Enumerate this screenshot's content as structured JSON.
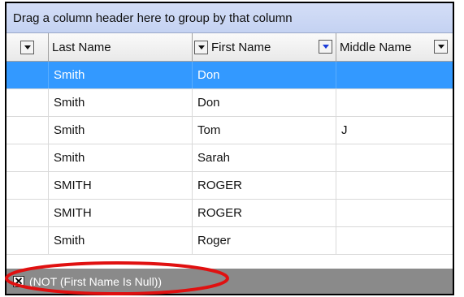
{
  "group_panel": {
    "text": "Drag a column header here to group by that column"
  },
  "columns": [
    {
      "label": "Last Name"
    },
    {
      "label": "First Name"
    },
    {
      "label": "Middle Name"
    }
  ],
  "rows": [
    {
      "last": "Smith",
      "first": "Don",
      "middle": "",
      "selected": true
    },
    {
      "last": "Smith",
      "first": "Don",
      "middle": ""
    },
    {
      "last": "Smith",
      "first": "Tom",
      "middle": "J"
    },
    {
      "last": "Smith",
      "first": "Sarah",
      "middle": ""
    },
    {
      "last": "SMITH",
      "first": "ROGER",
      "middle": ""
    },
    {
      "last": "SMITH",
      "first": "ROGER",
      "middle": ""
    },
    {
      "last": "Smith",
      "first": "Roger",
      "middle": ""
    }
  ],
  "filter": {
    "close_icon": "close-icon",
    "text": "(NOT (First Name Is Null))"
  },
  "colors": {
    "selection": "#3399ff",
    "group_panel": "#c9d6f4",
    "filter_bar": "#8a8a8a",
    "annotation": "#e01010",
    "active_filter_arrow": "#1a3bd8"
  }
}
